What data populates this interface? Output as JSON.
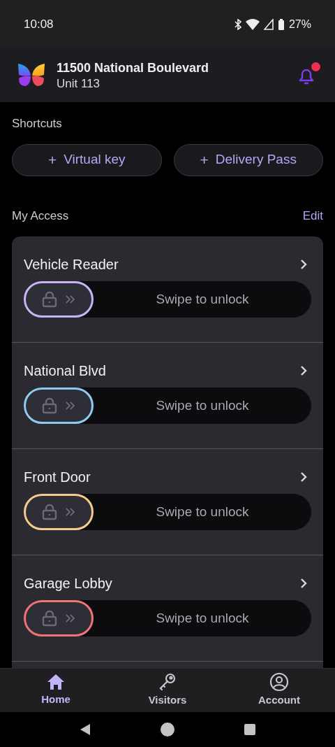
{
  "status_bar": {
    "time": "10:08",
    "battery": "27%"
  },
  "header": {
    "title": "11500 National Boulevard",
    "subtitle": "Unit 113",
    "bell": {
      "unread": true
    }
  },
  "shortcuts": {
    "title": "Shortcuts",
    "buttons": [
      {
        "icon": "+",
        "label": "Virtual key"
      },
      {
        "icon": "+",
        "label": "Delivery Pass"
      }
    ]
  },
  "my_access": {
    "title": "My Access",
    "action": "Edit",
    "items": [
      {
        "name": "Vehicle Reader",
        "slider": "Swipe to unlock",
        "color": "#c9b3f7"
      },
      {
        "name": "National Blvd",
        "slider": "Swipe to unlock",
        "color": "#8ecaf2"
      },
      {
        "name": "Front Door",
        "slider": "Swipe to unlock",
        "color": "#f6ca8e"
      },
      {
        "name": "Garage Lobby",
        "slider": "Swipe to unlock",
        "color": "#ef7473"
      }
    ]
  },
  "bottom_nav": [
    {
      "kind": "home",
      "label": "Home",
      "selected": true
    },
    {
      "kind": "key",
      "label": "Visitors",
      "selected": false
    },
    {
      "kind": "account",
      "label": "Account",
      "selected": false
    }
  ]
}
